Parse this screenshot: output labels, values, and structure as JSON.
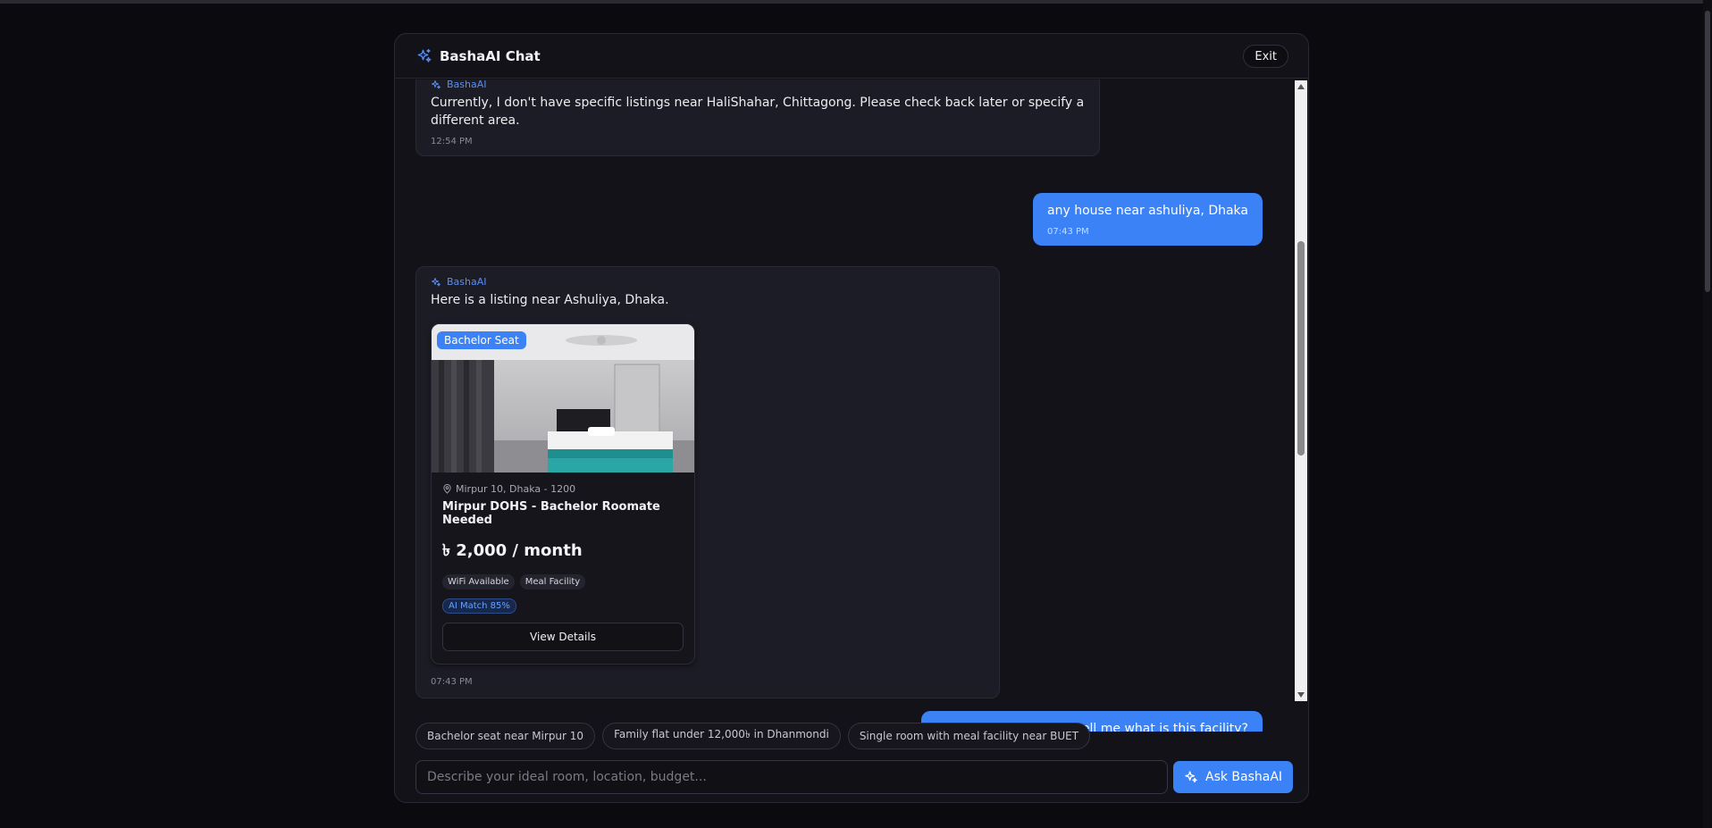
{
  "header": {
    "title": "BashaAI Chat",
    "exit_label": "Exit"
  },
  "messages": [
    {
      "role": "bot",
      "sender": "BashaAI",
      "text": "Currently, I don't have specific listings near HaliShahar, Chittagong. Please check back later or specify a different area.",
      "time": "12:54 PM"
    },
    {
      "role": "user",
      "text": "any house near ashuliya, Dhaka",
      "time": "07:43 PM"
    },
    {
      "role": "bot",
      "sender": "BashaAI",
      "text": "Here is a listing near Ashuliya, Dhaka.",
      "time": "07:43 PM",
      "card": {
        "badge": "Bachelor Seat",
        "location": "Mirpur 10, Dhaka - 1200",
        "title": "Mirpur DOHS - Bachelor Roomate Needed",
        "price": "৳ 2,000 / month",
        "tags": [
          "WiFi Available",
          "Meal Facility"
        ],
        "ai_match": "AI Match 85%",
        "button": "View Details"
      }
    },
    {
      "role": "user",
      "text": "okkk I seee... Can you tell me what is this facility?"
    }
  ],
  "suggestions": [
    "Bachelor seat near Mirpur 10",
    "Family flat under 12,000৳ in Dhanmondi",
    "Single room with meal facility near BUET"
  ],
  "input": {
    "placeholder": "Describe your ideal room, location, budget...",
    "value": ""
  },
  "ask_button": "Ask BashaAI",
  "colors": {
    "accent": "#3b82f6",
    "background": "#0b0b0f",
    "panel": "#121218",
    "bot_bubble": "#1c1c26"
  },
  "icons": {
    "header": "sparkle-icon",
    "location": "map-pin-icon"
  }
}
